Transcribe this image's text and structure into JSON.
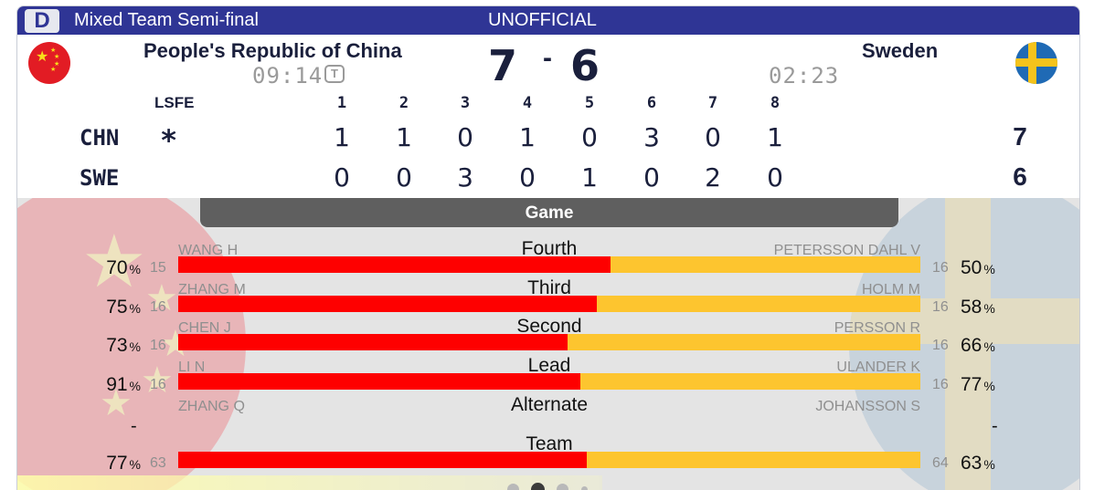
{
  "header": {
    "draw_badge": "D",
    "event": "Mixed Team Semi-final",
    "status": "UNOFFICIAL"
  },
  "teams": {
    "home": {
      "name": "People's Republic of China",
      "code": "CHN",
      "clock": "09:14",
      "timeout_badge": "T",
      "score": "7",
      "flag": "china-flag-icon"
    },
    "away": {
      "name": "Sweden",
      "code": "SWE",
      "clock": "02:23",
      "score": "6",
      "flag": "sweden-flag-icon"
    },
    "score_separator": "-"
  },
  "linescore": {
    "lsfe_label": "LSFE",
    "hammer_symbol": "*",
    "ends": [
      "1",
      "2",
      "3",
      "4",
      "5",
      "6",
      "7",
      "8"
    ],
    "home": [
      "1",
      "1",
      "0",
      "1",
      "0",
      "3",
      "0",
      "1"
    ],
    "away": [
      "0",
      "0",
      "3",
      "0",
      "1",
      "0",
      "2",
      "0"
    ],
    "home_total": "7",
    "away_total": "6"
  },
  "stats": {
    "tab_label": "Game",
    "percent_symbol": "%",
    "rows": [
      {
        "position": "Fourth",
        "home_player": "WANG H",
        "home_pct": "70",
        "home_shots": "15",
        "away_player": "PETERSSON DAHL V",
        "away_pct": "50",
        "away_shots": "16",
        "home_share": 0.583
      },
      {
        "position": "Third",
        "home_player": "ZHANG M",
        "home_pct": "75",
        "home_shots": "16",
        "away_player": "HOLM M",
        "away_pct": "58",
        "away_shots": "16",
        "home_share": 0.564
      },
      {
        "position": "Second",
        "home_player": "CHEN J",
        "home_pct": "73",
        "home_shots": "16",
        "away_player": "PERSSON R",
        "away_pct": "66",
        "away_shots": "16",
        "home_share": 0.525
      },
      {
        "position": "Lead",
        "home_player": "LI N",
        "home_pct": "91",
        "home_shots": "16",
        "away_player": "ULANDER K",
        "away_pct": "77",
        "away_shots": "16",
        "home_share": 0.542
      },
      {
        "position": "Alternate",
        "home_player": "ZHANG Q",
        "home_pct": "-",
        "home_shots": "",
        "away_player": "JOHANSSON S",
        "away_pct": "-",
        "away_shots": "",
        "home_share": null
      },
      {
        "position": "Team",
        "home_player": "",
        "home_pct": "77",
        "home_shots": "63",
        "away_player": "",
        "away_pct": "63",
        "away_shots": "64",
        "home_share": 0.55
      }
    ]
  },
  "pager": {
    "pages": 4,
    "active_index": 1
  }
}
